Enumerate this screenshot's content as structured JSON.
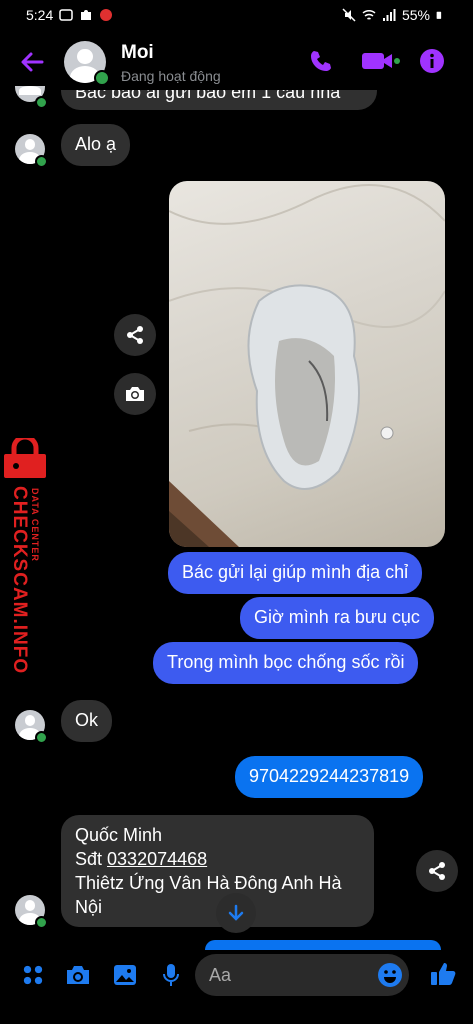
{
  "status_bar": {
    "time": "5:24",
    "battery": "55%"
  },
  "header": {
    "name": "Moi",
    "status": "Đang hoạt động"
  },
  "messages": {
    "cutoff_text": "Bác bảo ai gửi bảo em 1 câu nha",
    "alo": "Alo ạ",
    "sent1": "Bác gửi lại giúp mình địa chỉ",
    "sent2": "Giờ mình ra bưu cục",
    "sent3": "Trong mình bọc chống sốc rồi",
    "ok": "Ok",
    "number": "9704229244237819",
    "address_name": "Quốc Minh",
    "address_phone_label": "Sđt ",
    "address_phone": "0332074468",
    "address_line1": "Thiêtz Ứng Vân Hà Đông Anh Hà",
    "address_line2": "Nội"
  },
  "watermark": {
    "brand": "CHECKSCAM.INFO",
    "sub": "DATA CENTER"
  },
  "composer": {
    "placeholder": "Aa"
  },
  "colors": {
    "accent": "#a033ff",
    "sent_bubble": "#3d5bf0",
    "received_bubble": "#303030",
    "online": "#31a24c"
  }
}
